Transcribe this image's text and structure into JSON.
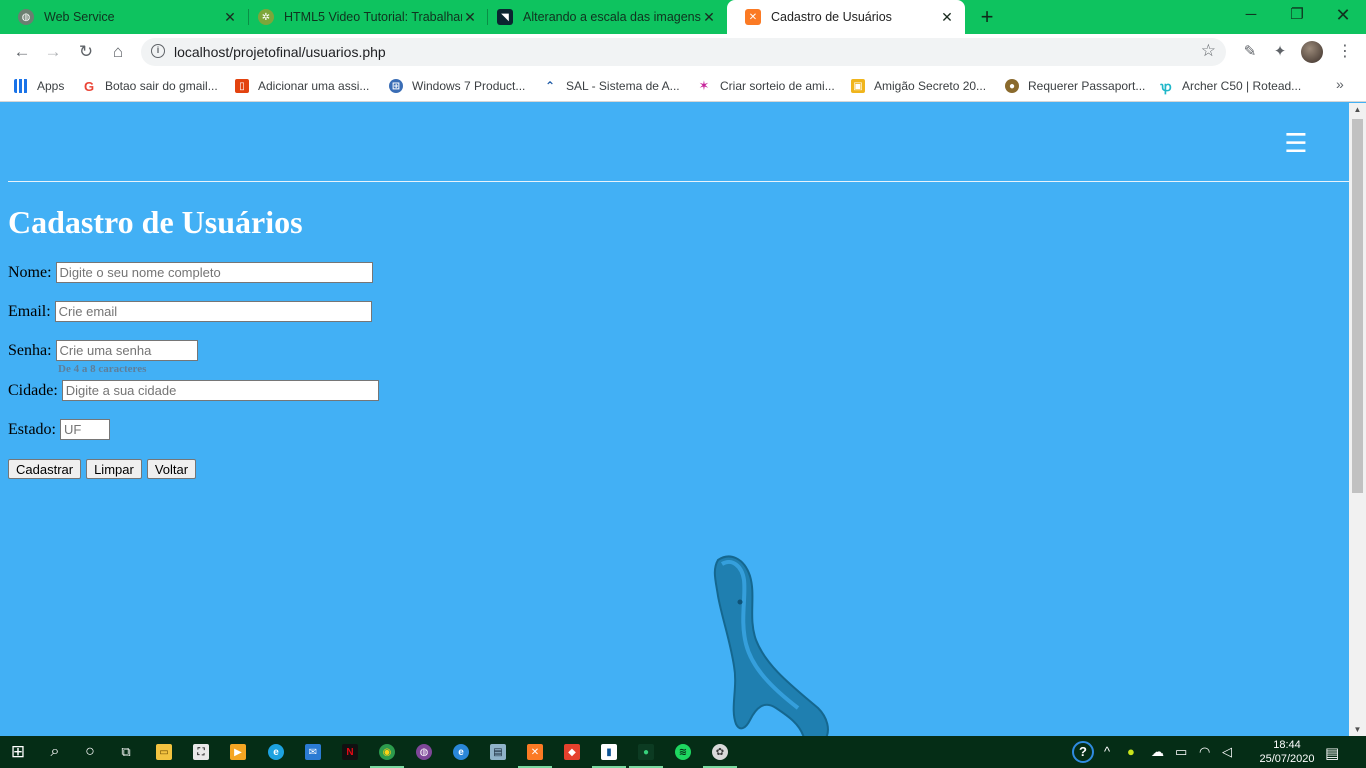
{
  "browser": {
    "tabs": [
      {
        "title": "Web Service",
        "icon": "globe-icon",
        "active": false
      },
      {
        "title": "HTML5 Video Tutorial: Trabalhan",
        "icon": "gear-icon",
        "active": false
      },
      {
        "title": "Alterando a escala das imagens c",
        "icon": "bird-icon",
        "active": false
      },
      {
        "title": "Cadastro de Usuários",
        "icon": "xampp-icon",
        "active": true
      }
    ],
    "url": "localhost/projetofinal/usuarios.php",
    "bookmarks": [
      {
        "label": "Apps",
        "icon": "apps-grid-icon"
      },
      {
        "label": "Botao sair do gmail...",
        "icon": "google-icon"
      },
      {
        "label": "Adicionar uma assi...",
        "icon": "office-icon"
      },
      {
        "label": "Windows 7 Product...",
        "icon": "windows-orb-icon"
      },
      {
        "label": "SAL - Sistema de A...",
        "icon": "sal-icon"
      },
      {
        "label": "Criar sorteio de ami...",
        "icon": "star-icon"
      },
      {
        "label": "Amigão Secreto 20...",
        "icon": "gift-icon"
      },
      {
        "label": "Requerer Passaport...",
        "icon": "badge-icon"
      },
      {
        "label": "Archer C50 | Rotead...",
        "icon": "tplink-icon"
      }
    ]
  },
  "page": {
    "title": "Cadastro de Usuários",
    "form": {
      "nome": {
        "label": "Nome:",
        "placeholder": "Digite o seu nome completo",
        "value": ""
      },
      "email": {
        "label": "Email:",
        "placeholder": "Crie email",
        "value": ""
      },
      "senha": {
        "label": "Senha:",
        "placeholder": "Crie uma senha",
        "value": "",
        "hint": "De 4 a 8 caracteres"
      },
      "cidade": {
        "label": "Cidade:",
        "placeholder": "Digite a sua cidade",
        "value": ""
      },
      "estado": {
        "label": "Estado:",
        "placeholder": "UF",
        "value": ""
      }
    },
    "buttons": {
      "submit": "Cadastrar",
      "reset": "Limpar",
      "back": "Voltar"
    }
  },
  "taskbar": {
    "time": "18:44",
    "date": "25/07/2020"
  },
  "colors": {
    "tabstrip": "#0ec35f",
    "page_background": "#42b0f5",
    "taskbar": "#052d16"
  }
}
